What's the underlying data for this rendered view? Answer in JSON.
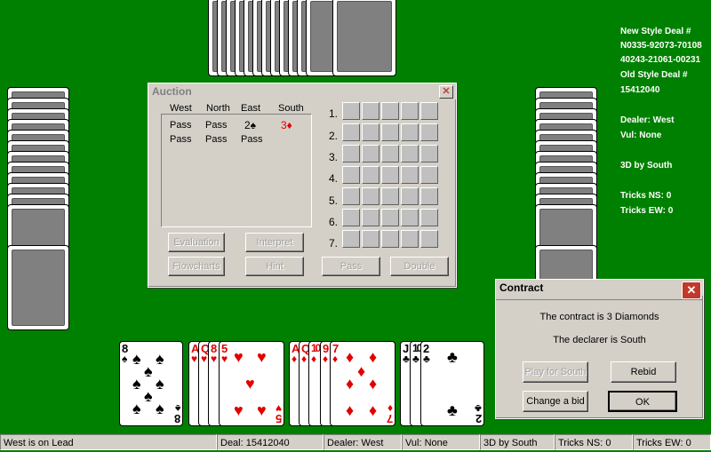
{
  "info": {
    "new_style_label": "New Style Deal #",
    "new_style_line1": "N0335-92073-70108",
    "new_style_line2": "40243-21061-00231",
    "old_style_label": "Old Style Deal #",
    "old_style_value": "15412040",
    "dealer": "Dealer: West",
    "vul": "Vul: None",
    "contract": "3D by South",
    "tricks_ns": "Tricks NS: 0",
    "tricks_ew": "Tricks EW: 0"
  },
  "auction": {
    "title": "Auction",
    "headers": [
      "West",
      "North",
      "East",
      "South"
    ],
    "rows": [
      [
        "Pass",
        "Pass",
        "2♠",
        "3♦"
      ],
      [
        "Pass",
        "Pass",
        "Pass",
        ""
      ]
    ],
    "levels": [
      "1.",
      "2.",
      "3.",
      "4.",
      "5.",
      "6.",
      "7."
    ],
    "buttons": {
      "evaluation": "Evaluation",
      "interpret": "Interpret",
      "flowcharts": "Flowcharts",
      "hint": "Hint",
      "pass": "Pass",
      "double": "Double"
    }
  },
  "contract_dialog": {
    "title": "Contract",
    "line1": "The contract is 3 Diamonds",
    "line2": "The declarer is South",
    "play_for_south": "Play for South",
    "rebid": "Rebid",
    "change_bid": "Change a bid",
    "ok": "OK"
  },
  "hand": {
    "spades": [
      "8"
    ],
    "hearts": [
      "A",
      "Q",
      "8",
      "5"
    ],
    "diamonds": [
      "A",
      "Q",
      "10",
      "9",
      "7"
    ],
    "clubs": [
      "J",
      "10",
      "2"
    ]
  },
  "status": {
    "lead": "West is on Lead",
    "deal": "Deal: 15412040",
    "dealer": "Dealer: West",
    "vul": "Vul: None",
    "contract": "3D by South",
    "tricks_ns": "Tricks NS: 0",
    "tricks_ew": "Tricks EW: 0"
  },
  "colors": {
    "table": "#008000",
    "red_suit": "#e00000",
    "dialog": "#d4d0c8"
  }
}
